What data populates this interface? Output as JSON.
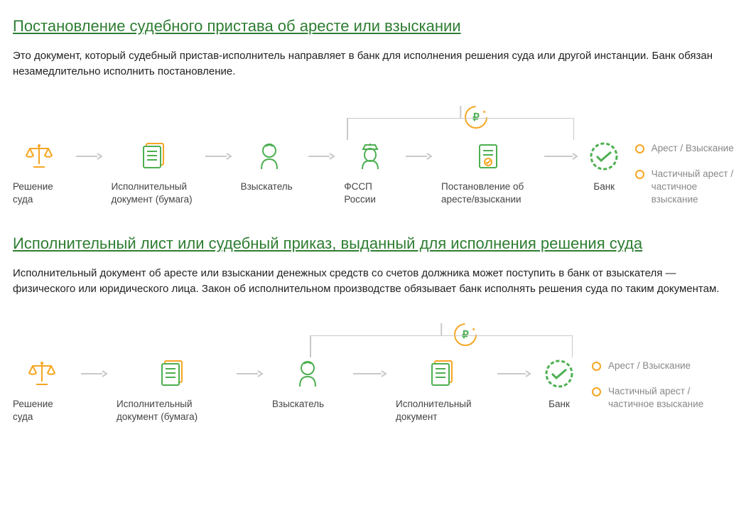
{
  "section1": {
    "heading": "Постановление судебного пристава об аресте или взыскании",
    "desc": "Это документ, который судебный пристав-исполнитель направляет в банк для исполнения решения суда или другой инстанции. Банк обязан незамедлительно исполнить постановление.",
    "steps": {
      "court": "Решение суда",
      "doc": "Исполнительный документ (бумага)",
      "claimant": "Взыскатель",
      "fssp": "ФССП России",
      "order": "Постановление об аресте/взыскании",
      "bank": "Банк"
    },
    "outcomes": {
      "a": "Арест / Взыскание",
      "b": "Частичный арест / частичное взыскание"
    },
    "ruble": "₽"
  },
  "section2": {
    "heading": "Исполнительный лист или судебный приказ, выданный для исполнения решения суда",
    "desc": "Исполнительный документ об аресте или взыскании денежных средств со счетов должника может поступить в банк от взыскателя — физического или юридического лица. Закон об исполнительном производстве обязывает банк исполнять решения суда по таким документам.",
    "steps": {
      "court": "Решение суда",
      "doc": "Исполнительный документ (бумага)",
      "claimant": "Взыскатель",
      "execdoc": "Исполнительный документ",
      "bank": "Банк"
    },
    "outcomes": {
      "a": "Арест / Взыскание",
      "b": "Частичный арест / частичное взыскание"
    },
    "ruble": "₽"
  }
}
